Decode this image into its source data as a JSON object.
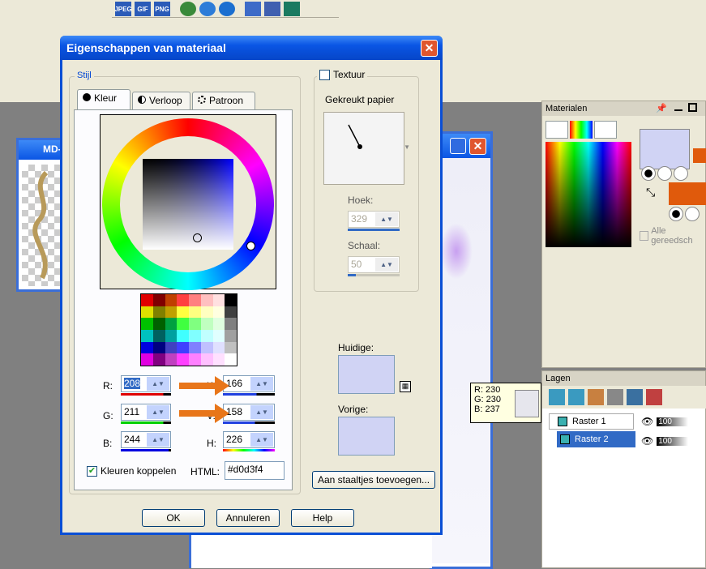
{
  "dialog": {
    "title": "Eigenschappen van materiaal",
    "close_glyph": "✕",
    "stijl_label": "Stijl",
    "tabs": [
      "Kleur",
      "Verloop",
      "Patroon"
    ],
    "rgb": {
      "r_label": "R:",
      "r_value": "208",
      "g_label": "G:",
      "g_value": "211",
      "b_label": "B:",
      "b_value": "244"
    },
    "hsv": {
      "k_label": "K:",
      "k_value": "166",
      "v_label": "V:",
      "v_value": "158",
      "h_label": "H:",
      "h_value": "226"
    },
    "link_colors_label": "Kleuren koppelen",
    "html_label": "HTML:",
    "html_value": "#d0d3f4",
    "texture_label": "Textuur",
    "texture_name": "Gekreukt papier",
    "angle_label": "Hoek:",
    "angle_value": "329",
    "scale_label": "Schaal:",
    "scale_value": "50",
    "current_label": "Huidige:",
    "previous_label": "Vorige:",
    "add_swatch_button": "Aan staaltjes toevoegen...",
    "ok_button": "OK",
    "cancel_button": "Annuleren",
    "help_button": "Help",
    "current_color": "#d0d3f4",
    "previous_color": "#d0d3f4"
  },
  "background": {
    "window_title_fragment": "MD-",
    "toolbar_icons": [
      "JPEG",
      "GIF",
      "PNG"
    ]
  },
  "materials_panel": {
    "title": "Materialen",
    "all_tools_label": "Alle gereedsch"
  },
  "layers_panel": {
    "title": "Lagen",
    "layers": [
      {
        "name": "Raster 1",
        "opacity": "100"
      },
      {
        "name": "Raster 2",
        "opacity": "100"
      }
    ]
  },
  "tooltip": {
    "r": "R: 230",
    "g": "G: 230",
    "b": "B: 237"
  },
  "colors": {
    "accent": "#0a55e4",
    "fg": "#d0d3f4",
    "bg": "#e05a0c",
    "arrow": "#e8761a"
  }
}
